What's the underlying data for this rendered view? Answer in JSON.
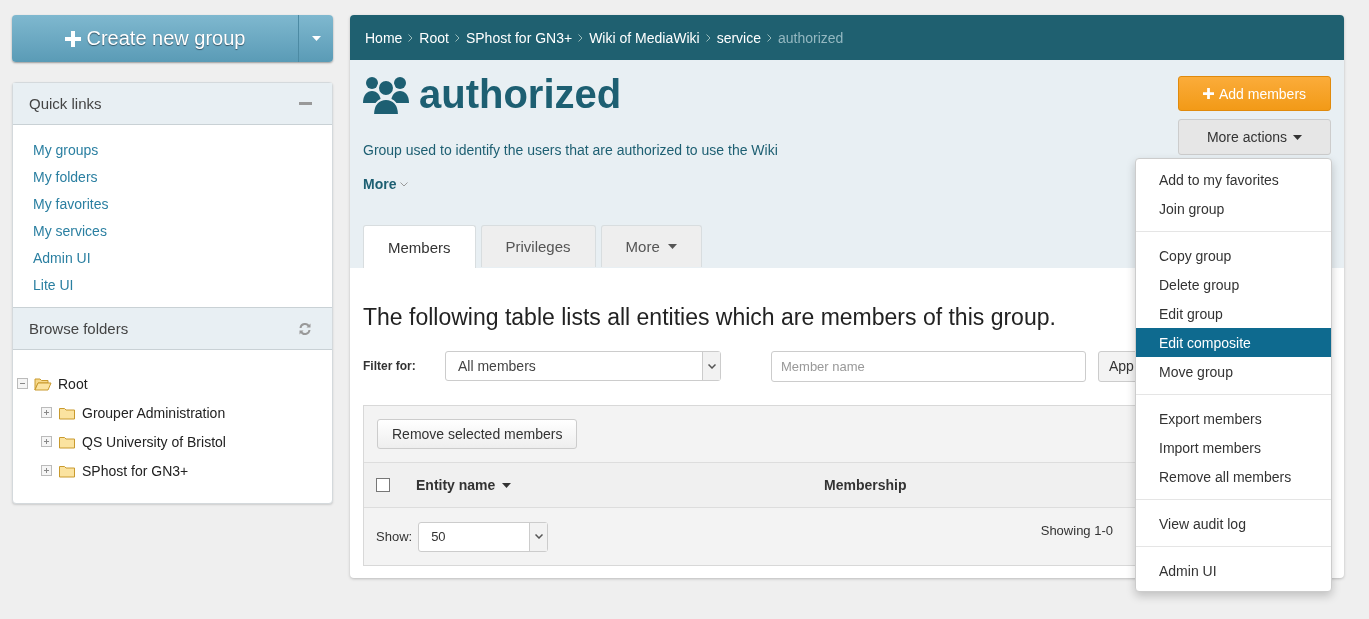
{
  "create_button": {
    "label": "Create new group"
  },
  "quick_links": {
    "title": "Quick links",
    "items": [
      "My groups",
      "My folders",
      "My favorites",
      "My services",
      "Admin UI",
      "Lite UI"
    ]
  },
  "browse_folders": {
    "title": "Browse folders",
    "tree": [
      {
        "label": "Root",
        "expanded": true,
        "children": [
          {
            "label": "Grouper Administration",
            "expanded": false
          },
          {
            "label": "QS University of Bristol",
            "expanded": false
          },
          {
            "label": "SPhost for GN3+",
            "expanded": false
          }
        ]
      }
    ]
  },
  "breadcrumb": [
    {
      "label": "Home",
      "current": false
    },
    {
      "label": "Root",
      "current": false
    },
    {
      "label": "SPhost for GN3+",
      "current": false
    },
    {
      "label": "Wiki of MediaWiki",
      "current": false
    },
    {
      "label": "service",
      "current": false
    },
    {
      "label": "authorized",
      "current": true
    }
  ],
  "group": {
    "title": "authorized",
    "description": "Group used to identify the users that are authorized to use the Wiki",
    "more": "More"
  },
  "add_members": "Add members",
  "more_actions": "More actions",
  "tabs": [
    {
      "label": "Members",
      "selected": true,
      "dropdown": false
    },
    {
      "label": "Privileges",
      "selected": false,
      "dropdown": false
    },
    {
      "label": "More",
      "selected": false,
      "dropdown": true
    }
  ],
  "heading": "The following table lists all entities which are members of this group.",
  "filter": {
    "label": "Filter for:",
    "value": "All members",
    "search_placeholder": "Member name",
    "apply": "App"
  },
  "remove_selected": "Remove selected members",
  "table": {
    "checked": false,
    "columns": [
      "Entity name",
      "Membership"
    ]
  },
  "footer": {
    "show_label": "Show:",
    "page_size": "50",
    "showing": "Showing 1-0"
  },
  "menu": [
    [
      {
        "label": "Add to my favorites",
        "selected": false
      },
      {
        "label": "Join group",
        "selected": false
      }
    ],
    [
      {
        "label": "Copy group",
        "selected": false
      },
      {
        "label": "Delete group",
        "selected": false
      },
      {
        "label": "Edit group",
        "selected": false
      },
      {
        "label": "Edit composite",
        "selected": true
      },
      {
        "label": "Move group",
        "selected": false
      }
    ],
    [
      {
        "label": "Export members",
        "selected": false
      },
      {
        "label": "Import members",
        "selected": false
      },
      {
        "label": "Remove all members",
        "selected": false
      }
    ],
    [
      {
        "label": "View audit log",
        "selected": false
      }
    ],
    [
      {
        "label": "Admin UI",
        "selected": false
      }
    ]
  ]
}
